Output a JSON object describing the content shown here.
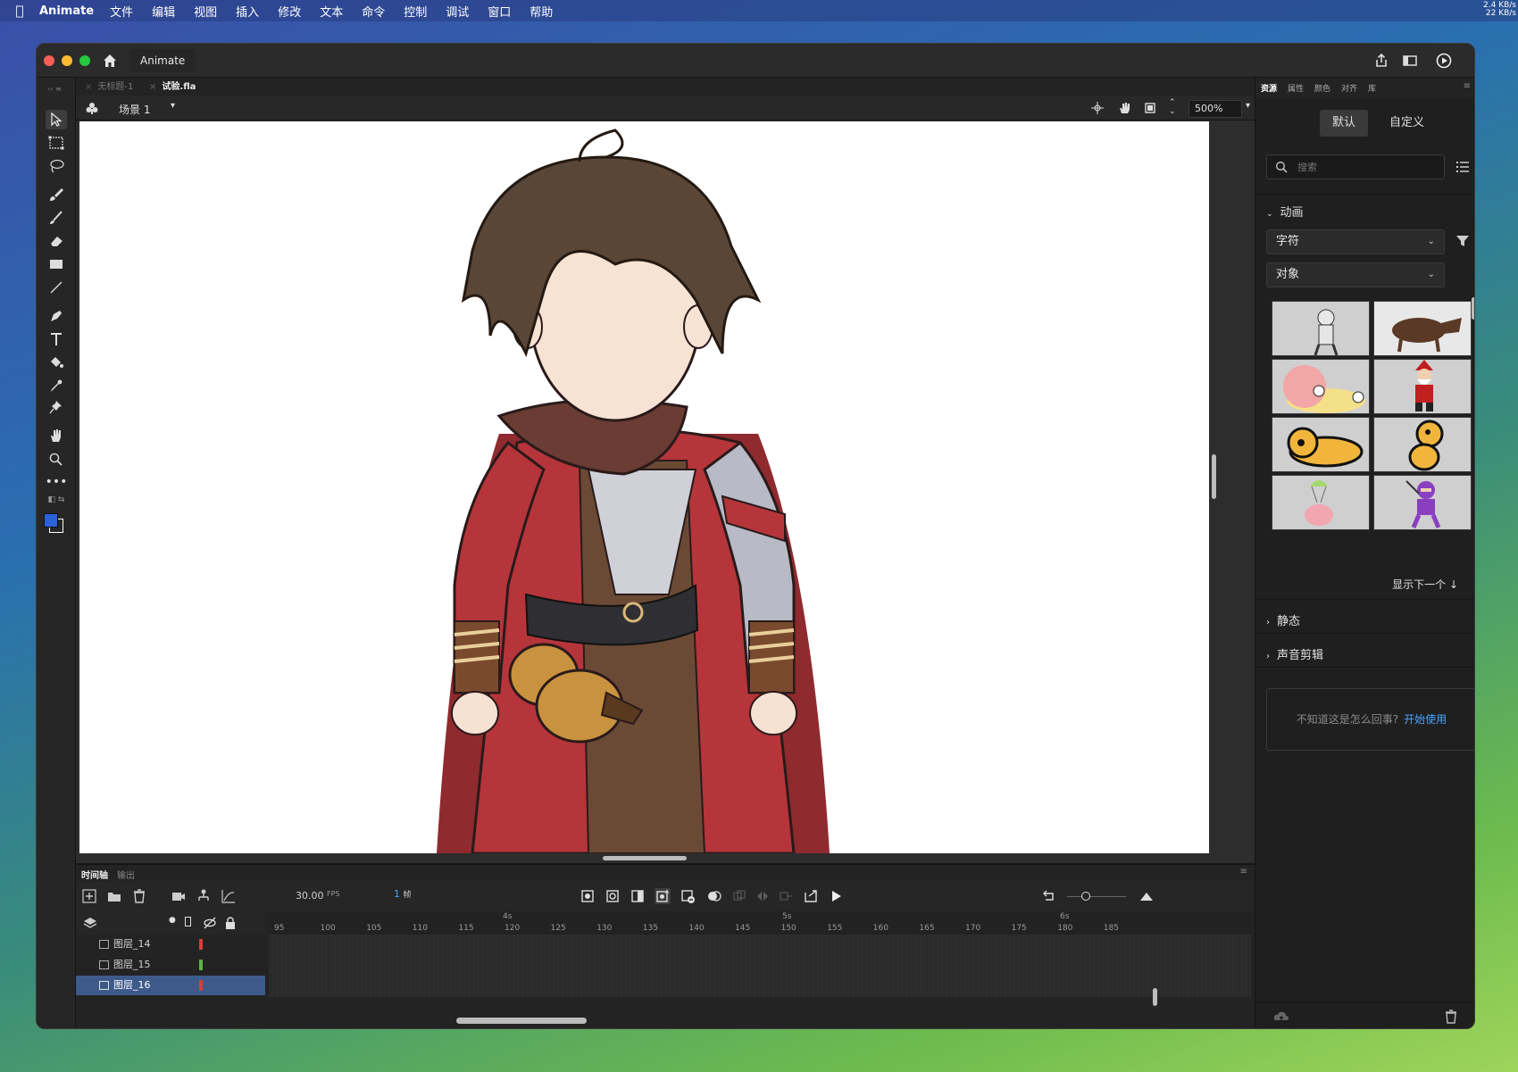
{
  "menubar": {
    "app_name": "Animate",
    "items": [
      "文件",
      "编辑",
      "视图",
      "插入",
      "修改",
      "文本",
      "命令",
      "控制",
      "调试",
      "窗口",
      "帮助"
    ],
    "net_up": "2.4 KB/s",
    "net_down": "22 KB/s"
  },
  "titlebar": {
    "app_tab": "Animate"
  },
  "doc_tabs": [
    "无标题-1",
    "试验.fla"
  ],
  "scene": {
    "label": "场景 1",
    "zoom": "500%"
  },
  "timeline": {
    "tabs": [
      "时间轴",
      "输出"
    ],
    "fps": "30.00",
    "fps_unit": "FPS",
    "current_frame": "1",
    "frame_unit": "帧",
    "frame_ticks": [
      "95",
      "100",
      "105",
      "110",
      "115",
      "120",
      "125",
      "130",
      "135",
      "140",
      "145",
      "150",
      "155",
      "160",
      "165",
      "170",
      "175",
      "180",
      "185"
    ],
    "second_marks": [
      "4s",
      "5s",
      "6s"
    ],
    "layers": [
      {
        "name": "图层_14",
        "color": "#e03a3a",
        "selected": false
      },
      {
        "name": "图层_15",
        "color": "#5fb43a",
        "selected": false
      },
      {
        "name": "图层_16",
        "color": "#e03a3a",
        "selected": true
      }
    ]
  },
  "right_panel": {
    "tabs": [
      "资源",
      "属性",
      "颜色",
      "对齐",
      "库"
    ],
    "segment": [
      "默认",
      "自定义"
    ],
    "search_placeholder": "搜索",
    "section_animation": "动画",
    "dropdown_1": "字符",
    "dropdown_2": "对象",
    "show_next": "显示下一个 ↓",
    "section_static": "静态",
    "section_sound": "声音剪辑",
    "help_text": "不知道这是怎么回事?",
    "help_link": "开始使用"
  },
  "colors": {
    "fill": "#2a63d8",
    "stroke": "#ffffff"
  }
}
